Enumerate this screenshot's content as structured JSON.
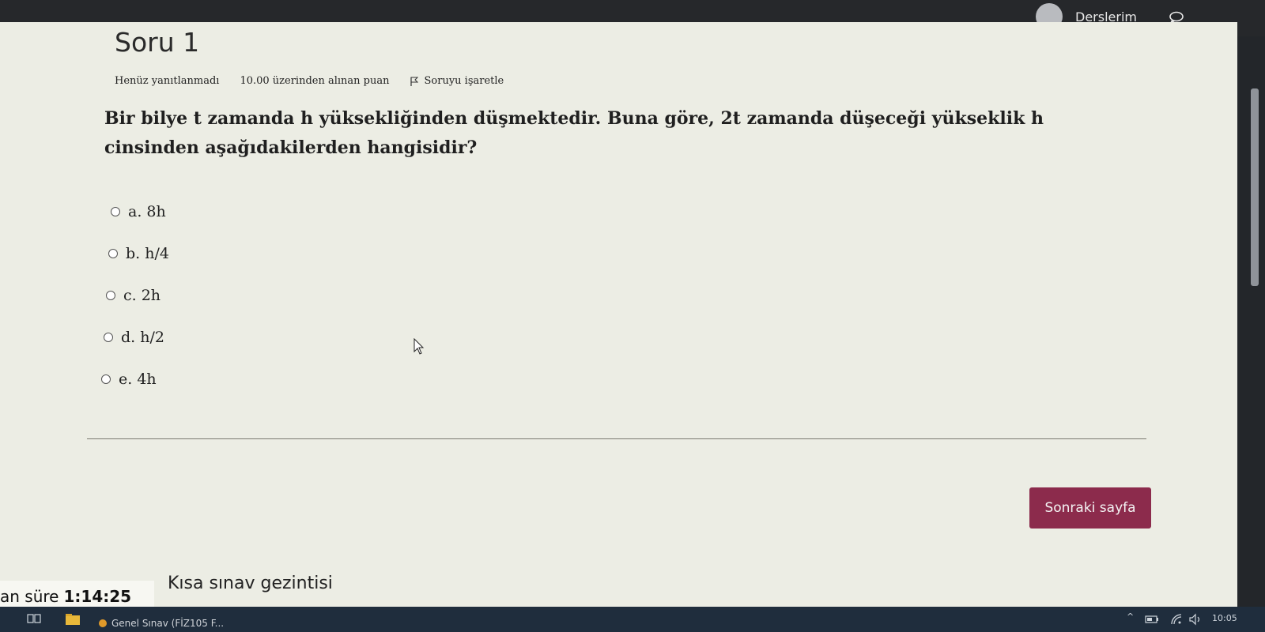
{
  "nav": {
    "user_link": "Derslerim"
  },
  "question": {
    "title": "Soru 1",
    "status": "Henüz yanıtlanmadı",
    "points": "10.00 üzerinden alınan puan",
    "flag_label": "Soruyu işaretle",
    "text": "Bir bilye t zamanda h yüksekliğinden düşmektedir. Buna göre, 2t zamanda düşeceği yükseklik h cinsinden aşağıdakilerden hangisidir?",
    "options": [
      {
        "label": "a. 8h",
        "selected": false
      },
      {
        "label": "b. h/4",
        "selected": false
      },
      {
        "label": "c. 2h",
        "selected": false
      },
      {
        "label": "d. h/2",
        "selected": false
      },
      {
        "label": "e. 4h",
        "selected": false
      }
    ]
  },
  "next_button": "Sonraki sayfa",
  "timer": {
    "label": "an süre",
    "value": "1:14:25"
  },
  "quiz_navigation": "Kısa sınav gezintisi",
  "taskbar": {
    "app_title": "Genel Sınav (FİZ105 F...",
    "clock": "10:05"
  },
  "colors": {
    "accent": "#8c2b4c",
    "page_bg": "#ecede4",
    "taskbar_bg": "#1f2d3d"
  }
}
